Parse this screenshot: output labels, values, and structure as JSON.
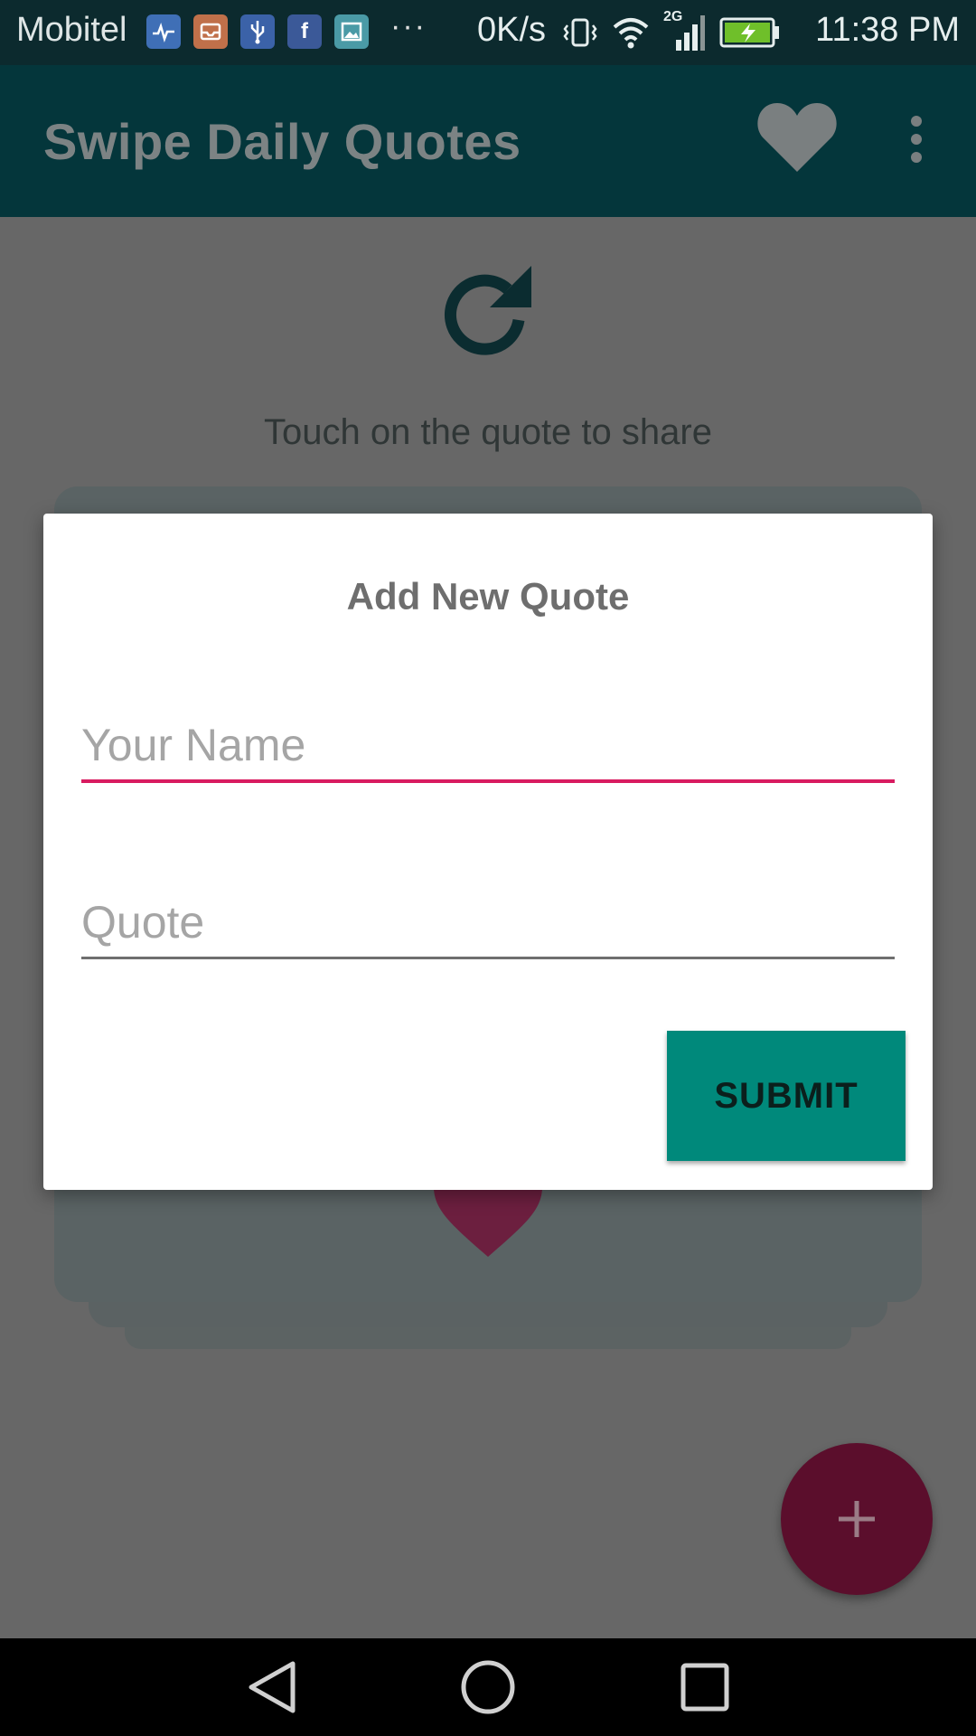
{
  "status_bar": {
    "carrier": "Mobitel",
    "more_indicator": "···",
    "net_speed": "0K/s",
    "network_type": "2G",
    "time": "11:38 PM",
    "notification_icons": [
      "health-icon",
      "inbox-icon",
      "usb-icon",
      "facebook-icon",
      "gallery-icon"
    ]
  },
  "app_bar": {
    "title": "Swipe Daily Quotes",
    "favorites_icon": "heart-icon",
    "menu_icon": "overflow-menu-icon"
  },
  "content": {
    "refresh_icon": "refresh-icon",
    "hint": "Touch on the quote to share"
  },
  "dialog": {
    "title": "Add New Quote",
    "name_placeholder": "Your Name",
    "name_value": "",
    "quote_placeholder": "Quote",
    "quote_value": "",
    "submit_label": "SUBMIT"
  },
  "fab": {
    "icon": "plus-icon"
  },
  "nav_bar": {
    "buttons": [
      "back-icon",
      "home-icon",
      "recents-icon"
    ]
  },
  "colors": {
    "app_bar": "#04363b",
    "accent": "#d81b60",
    "submit": "#00897b",
    "fab": "#5b0e2c"
  }
}
